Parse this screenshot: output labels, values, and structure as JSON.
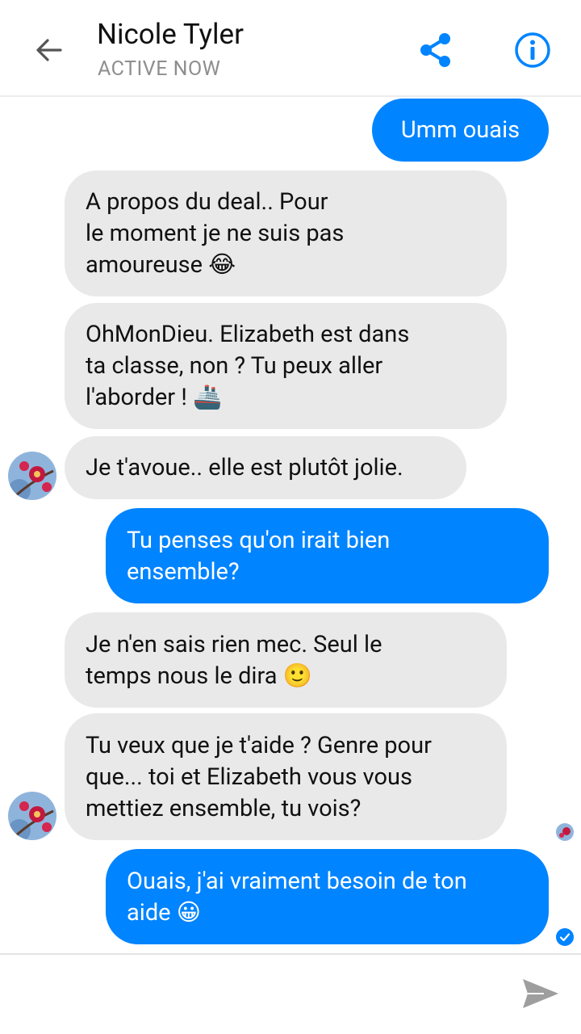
{
  "header": {
    "title": "Nicole Tyler",
    "status": "ACTIVE NOW",
    "icons": [
      "back-arrow-icon",
      "share-icon",
      "info-icon"
    ]
  },
  "colors": {
    "accent": "#0084ff",
    "incoming_bubble": "#e9e9e9",
    "status_text": "#8e8e8e"
  },
  "messages": [
    {
      "direction": "out",
      "text": "Umm ouais"
    },
    {
      "direction": "in",
      "lines": [
        "A propos du deal.. Pour",
        "le moment je ne suis pas",
        "amoureuse 😂"
      ]
    },
    {
      "direction": "in",
      "lines": [
        "OhMonDieu. Elizabeth est dans",
        "ta classe, non ? Tu peux aller",
        "l'aborder ! 🚢"
      ]
    },
    {
      "direction": "in",
      "lines": [
        "Je t'avoue.. elle est plutôt jolie."
      ]
    },
    {
      "direction": "out",
      "lines": [
        "Tu penses qu'on irait bien",
        "ensemble?"
      ]
    },
    {
      "direction": "in",
      "lines": [
        "Je n'en sais rien mec. Seul le",
        "temps nous le dira 🙂"
      ]
    },
    {
      "direction": "in",
      "lines": [
        "Tu veux que je t'aide ? Genre pour",
        "que... toi et Elizabeth vous vous",
        "mettiez ensemble, tu vois?"
      ]
    },
    {
      "direction": "out",
      "lines": [
        "Ouais, j'ai vraiment besoin de ton",
        "aide 😀"
      ]
    }
  ],
  "composer": {
    "send_icon": "send-icon"
  }
}
